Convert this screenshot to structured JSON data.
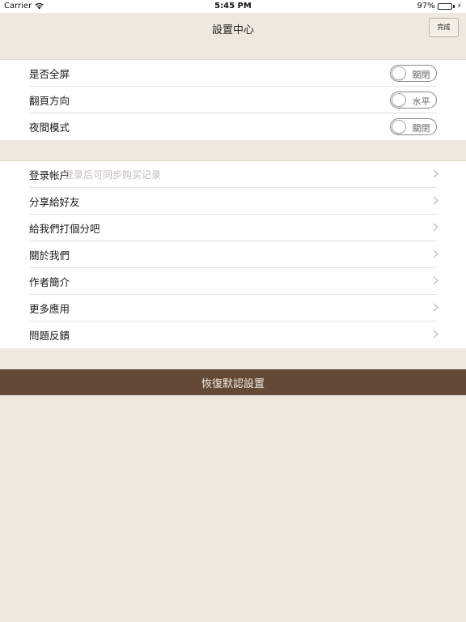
{
  "status_bar": {
    "carrier": "Carrier",
    "time": "5:45 PM",
    "battery": "97%",
    "battery_level": 0.97,
    "wifi_icon": "wifi-icon",
    "battery_icon": "battery-icon"
  },
  "nav": {
    "title": "設置中心",
    "done_label": "完成"
  },
  "settings": {
    "fullscreen": {
      "label": "是否全屏",
      "toggle": "關閉"
    },
    "page_direction": {
      "label": "翻頁方向",
      "toggle": "水平"
    },
    "night_mode": {
      "label": "夜間模式",
      "toggle": "關閉"
    }
  },
  "menu": {
    "login": {
      "label": "登录帐户",
      "hint": "登录后可同步购买记录"
    },
    "share": {
      "label": "分享給好友"
    },
    "rate": {
      "label": "給我們打個分吧"
    },
    "about": {
      "label": "關於我們"
    },
    "author": {
      "label": "作者簡介"
    },
    "more_apps": {
      "label": "更多應用"
    },
    "feedback": {
      "label": "問題反饋"
    }
  },
  "reset_button": {
    "label": "恢復默認設置"
  },
  "colors": {
    "background": "#f0e8df",
    "reset_bar": "#644936",
    "battery": "#2bbd3c"
  }
}
